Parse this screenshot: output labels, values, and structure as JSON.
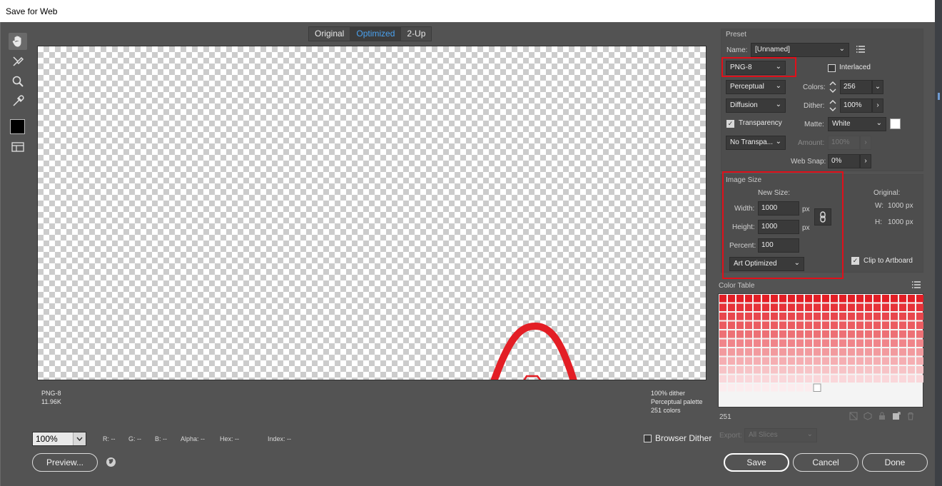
{
  "window": {
    "title": "Save for Web"
  },
  "tools": [
    {
      "name": "hand-tool-icon"
    },
    {
      "name": "slice-select-tool-icon"
    },
    {
      "name": "zoom-tool-icon"
    },
    {
      "name": "eyedropper-tool-icon"
    }
  ],
  "view_tabs": [
    "Original",
    "Optimized",
    "2-Up"
  ],
  "selected_tab": "Optimized",
  "image_info": {
    "left": [
      "PNG-8",
      "11.96K"
    ],
    "right": [
      "100% dither",
      "Perceptual palette",
      "251 colors"
    ]
  },
  "status": {
    "zoom": "100%",
    "r": "R: --",
    "g": "G: --",
    "b": "B: --",
    "alpha": "Alpha: --",
    "hex": "Hex: --",
    "index": "Index: --",
    "browser_dither": "Browser Dither"
  },
  "buttons": {
    "preview": "Preview...",
    "save": "Save",
    "cancel": "Cancel",
    "done": "Done"
  },
  "preset": {
    "section": "Preset",
    "name_label": "Name:",
    "name_value": "[Unnamed]",
    "format": "PNG-8",
    "interlaced": "Interlaced",
    "reduction": "Perceptual",
    "colors_label": "Colors:",
    "colors_value": "256",
    "dither_algo": "Diffusion",
    "dither_label": "Dither:",
    "dither_value": "100%",
    "transparency": "Transparency",
    "matte_label": "Matte:",
    "matte_value": "White",
    "transparency_dither": "No Transpa...",
    "amount_label": "Amount:",
    "amount_value": "100%",
    "websnap_label": "Web Snap:",
    "websnap_value": "0%"
  },
  "image_size": {
    "section": "Image Size",
    "new_size": "New Size:",
    "width_label": "Width:",
    "width_value": "1000",
    "height_label": "Height:",
    "height_value": "1000",
    "unit": "px",
    "percent_label": "Percent:",
    "percent_value": "100",
    "quality": "Art Optimized",
    "original_label": "Original:",
    "orig_w": "W:",
    "orig_w_value": "1000 px",
    "orig_h": "H:",
    "orig_h_value": "1000 px",
    "clip": "Clip to Artboard"
  },
  "color_table": {
    "section": "Color Table",
    "count": "251",
    "export_label": "Export:",
    "export_value": "All Slices"
  },
  "colors": {
    "accent": "#4aa2f0",
    "highlight": "#e0101a",
    "artwork": "#e31e25"
  }
}
